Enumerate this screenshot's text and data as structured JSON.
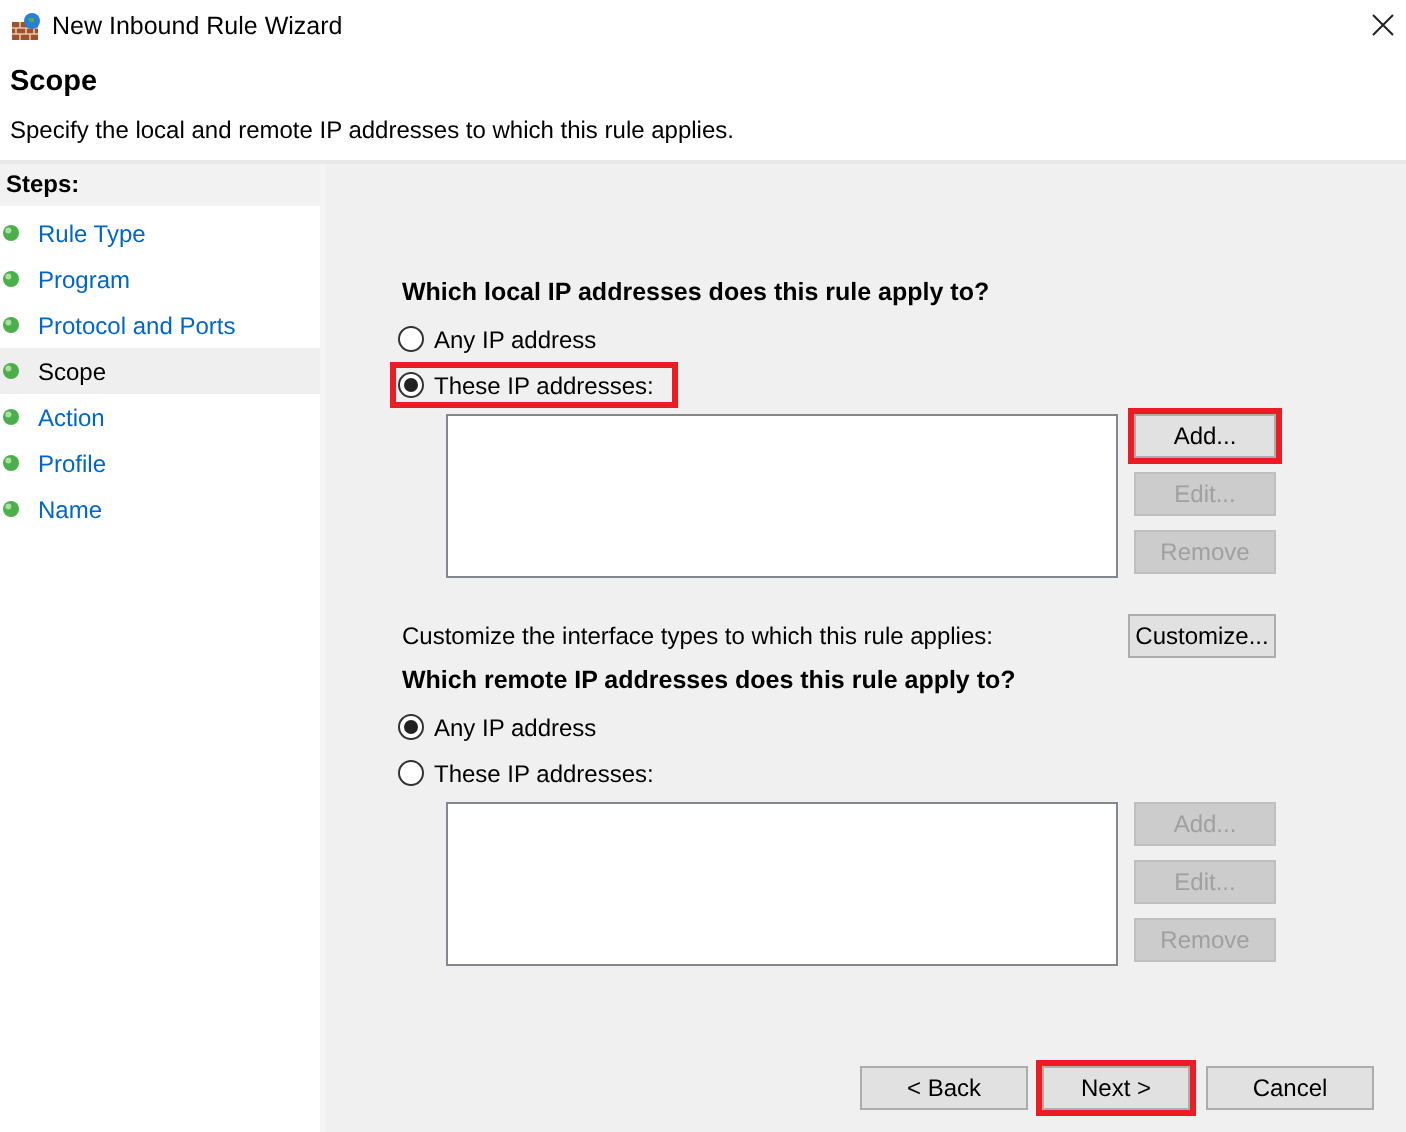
{
  "window": {
    "title": "New Inbound Rule Wizard"
  },
  "page": {
    "title": "Scope",
    "description": "Specify the local and remote IP addresses to which this rule applies."
  },
  "steps": {
    "heading": "Steps:",
    "items": [
      {
        "label": "Rule Type",
        "selected": false
      },
      {
        "label": "Program",
        "selected": false
      },
      {
        "label": "Protocol and Ports",
        "selected": false
      },
      {
        "label": "Scope",
        "selected": true
      },
      {
        "label": "Action",
        "selected": false
      },
      {
        "label": "Profile",
        "selected": false
      },
      {
        "label": "Name",
        "selected": false
      }
    ]
  },
  "local": {
    "question": "Which local IP addresses does this rule apply to?",
    "options": [
      {
        "label": "Any IP address",
        "selected": false,
        "highlighted": false
      },
      {
        "label": "These IP addresses:",
        "selected": true,
        "highlighted": true
      }
    ],
    "buttons": [
      {
        "label": "Add...",
        "disabled": false,
        "highlighted": true
      },
      {
        "label": "Edit...",
        "disabled": true,
        "highlighted": false
      },
      {
        "label": "Remove",
        "disabled": true,
        "highlighted": false
      }
    ]
  },
  "interface_types": {
    "text": "Customize the interface types to which this rule applies:",
    "button": {
      "label": "Customize...",
      "disabled": false,
      "highlighted": false
    }
  },
  "remote": {
    "question": "Which remote IP addresses does this rule apply to?",
    "options": [
      {
        "label": "Any IP address",
        "selected": true,
        "highlighted": false
      },
      {
        "label": "These IP addresses:",
        "selected": false,
        "highlighted": false
      }
    ],
    "buttons": [
      {
        "label": "Add...",
        "disabled": true,
        "highlighted": false
      },
      {
        "label": "Edit...",
        "disabled": true,
        "highlighted": false
      },
      {
        "label": "Remove",
        "disabled": true,
        "highlighted": false
      }
    ]
  },
  "footer_buttons": [
    {
      "label": "< Back",
      "disabled": false,
      "highlighted": false
    },
    {
      "label": "Next >",
      "disabled": false,
      "highlighted": true
    },
    {
      "label": "Cancel",
      "disabled": false,
      "highlighted": false
    }
  ]
}
